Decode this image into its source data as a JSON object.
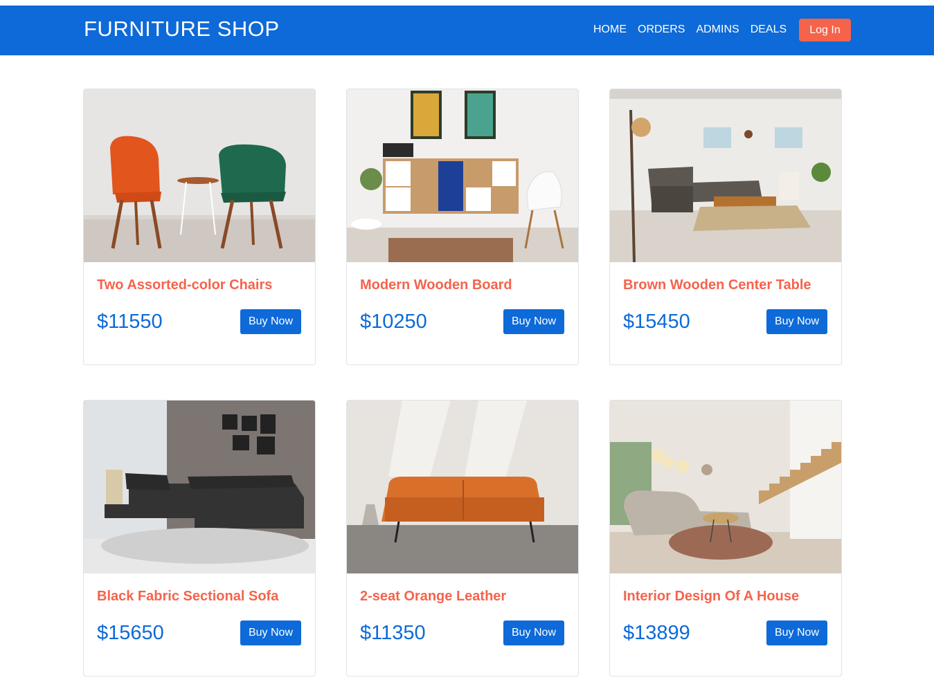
{
  "header": {
    "brand": "FURNITURE SHOP",
    "nav": [
      "HOME",
      "ORDERS",
      "ADMINS",
      "DEALS"
    ],
    "login_label": "Log In"
  },
  "colors": {
    "primary": "#0d6ad8",
    "accent": "#f5634b"
  },
  "products": [
    {
      "title": "Two Assorted-color Chairs",
      "price": "$11550",
      "button": "Buy Now",
      "image": "orange-and-green-chairs-photo"
    },
    {
      "title": "Modern Wooden Board",
      "price": "$10250",
      "button": "Buy Now",
      "image": "wooden-cabinet-with-paintings-photo"
    },
    {
      "title": "Brown Wooden Center Table",
      "price": "$15450",
      "button": "Buy Now",
      "image": "living-room-with-center-table-photo"
    },
    {
      "title": "Black Fabric Sectional Sofa",
      "price": "$15650",
      "button": "Buy Now",
      "image": "black-sectional-sofa-photo"
    },
    {
      "title": "2-seat Orange Leather",
      "price": "$11350",
      "button": "Buy Now",
      "image": "orange-leather-sofa-photo"
    },
    {
      "title": "Interior Design Of A House",
      "price": "$13899",
      "button": "Buy Now",
      "image": "house-interior-with-stairs-photo"
    }
  ]
}
